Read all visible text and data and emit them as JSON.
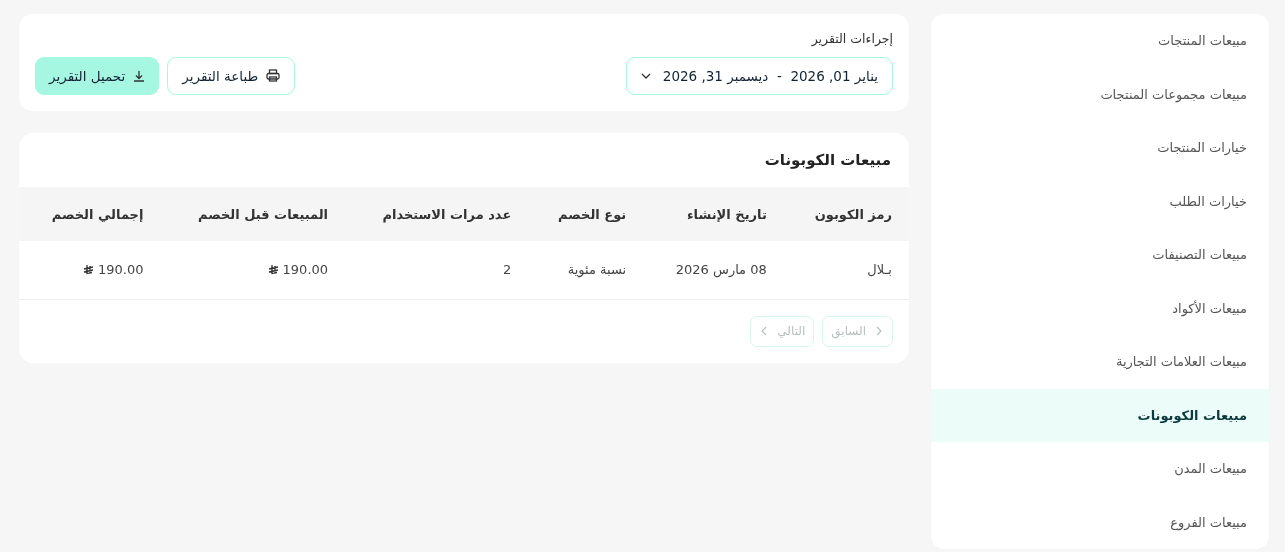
{
  "sidebar": {
    "items": [
      {
        "label": "مبيعات المنتجات",
        "selected": false
      },
      {
        "label": "مبيعات مجموعات المنتجات",
        "selected": false
      },
      {
        "label": "خيارات المنتجات",
        "selected": false
      },
      {
        "label": "خيارات الطلب",
        "selected": false
      },
      {
        "label": "مبيعات التصنيفات",
        "selected": false
      },
      {
        "label": "مبيعات الأكواد",
        "selected": false
      },
      {
        "label": "مبيعات العلامات التجارية",
        "selected": false
      },
      {
        "label": "مبيعات الكوبونات",
        "selected": true
      },
      {
        "label": "مبيعات المدن",
        "selected": false
      },
      {
        "label": "مبيعات الفروع",
        "selected": false
      }
    ]
  },
  "actions": {
    "title": "إجراءات التقرير",
    "date_range": "يناير 01, 2026  -  ديسمبر 31, 2026",
    "print_button": "طباعة التقرير",
    "download_button": "تحميل التقرير"
  },
  "report": {
    "title": "مبيعات الكوبونات",
    "table": {
      "columns": [
        "رمز الكوبون",
        "تاريخ الإنشاء",
        "نوع الخصم",
        "عدد مرات الاستخدام",
        "المبيعات قبل الخصم",
        "إجمالي الخصم"
      ],
      "rows": [
        {
          "cells": [
            {
              "kind": "text",
              "text": "بـلال"
            },
            {
              "kind": "text",
              "text": "08 مارس 2026"
            },
            {
              "kind": "text",
              "text": "نسبة مئوية"
            },
            {
              "kind": "text",
              "text": "2"
            },
            {
              "kind": "money",
              "text": "190.00"
            },
            {
              "kind": "money",
              "text": "190.00"
            }
          ]
        }
      ]
    },
    "pagination": {
      "previous": {
        "label": "السابق",
        "disabled": true
      },
      "next": {
        "label": "التالي",
        "disabled": true
      }
    }
  }
}
